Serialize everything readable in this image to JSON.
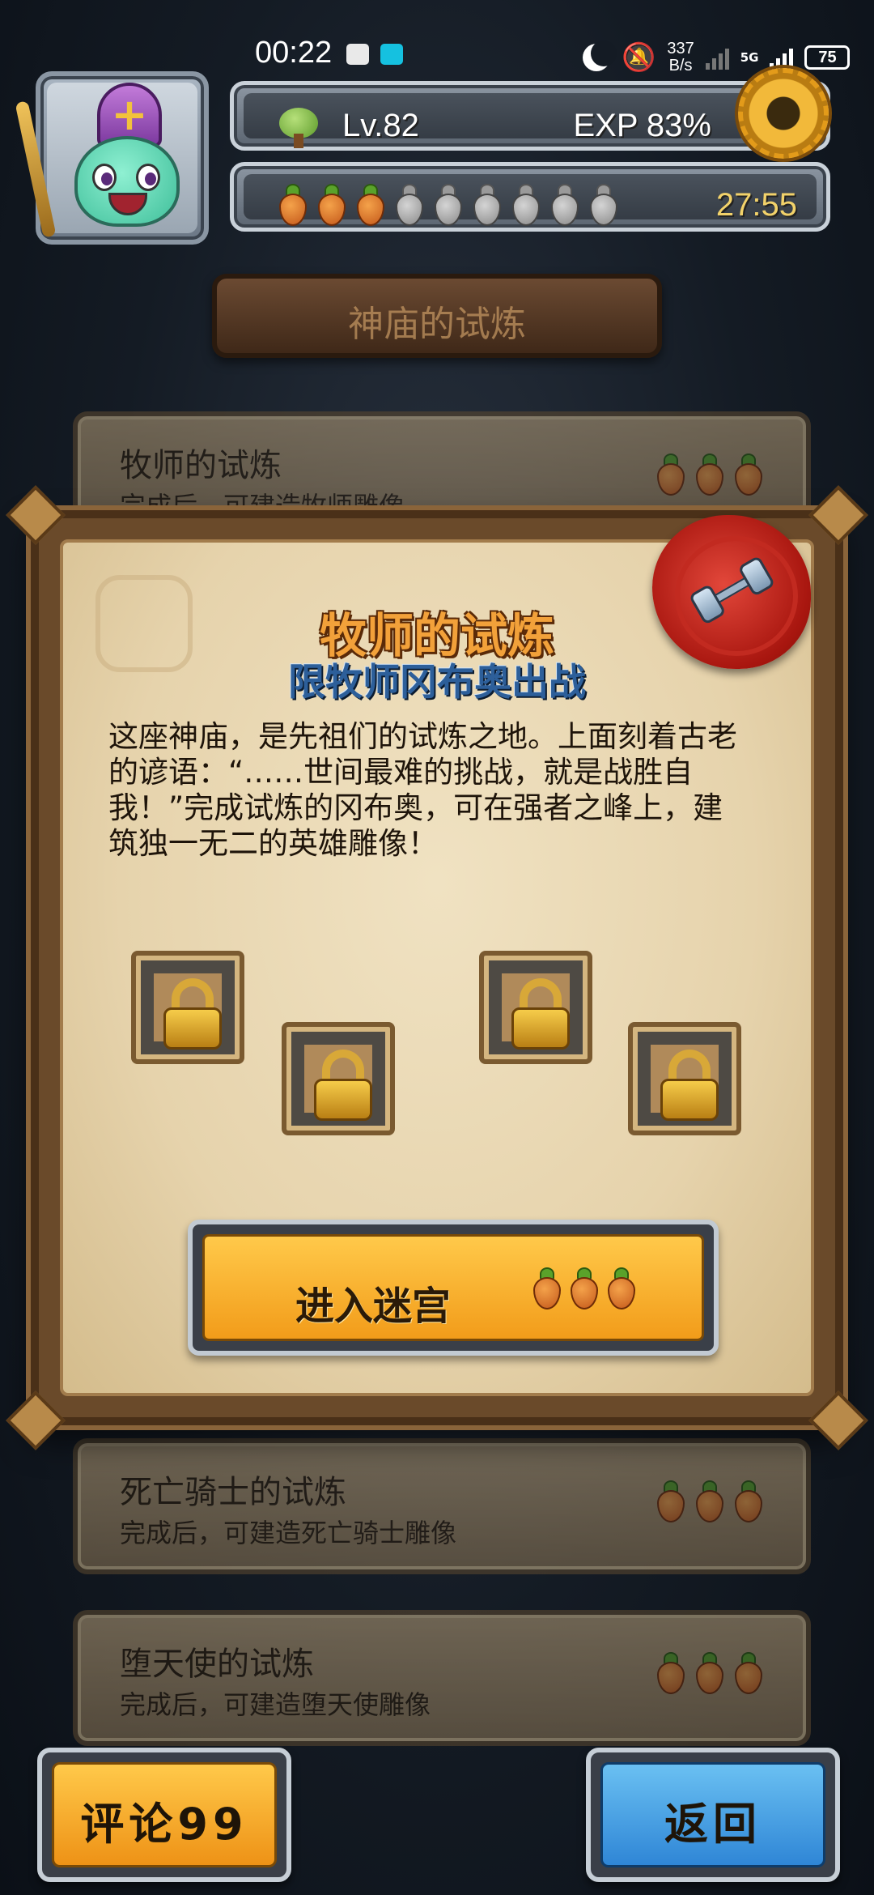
{
  "status_bar": {
    "time": "00:22",
    "network_speed_value": "337",
    "network_speed_unit": "B/s",
    "network_type": "5G",
    "battery": "75"
  },
  "hud": {
    "level": "Lv.82",
    "exp": "EXP 83%",
    "energy_full": 3,
    "energy_total": 9,
    "timer": "27:55"
  },
  "page": {
    "title": "神庙的试炼"
  },
  "trials": [
    {
      "title": "牧师的试炼",
      "subtitle": "完成后，可建造牧师雕像",
      "cost_carrots": 3
    },
    {
      "title": "死亡骑士的试炼",
      "subtitle": "完成后，可建造死亡骑士雕像",
      "cost_carrots": 3
    },
    {
      "title": "堕天使的试炼",
      "subtitle": "完成后，可建造堕天使雕像",
      "cost_carrots": 3
    }
  ],
  "modal": {
    "title": "牧师的试炼",
    "subtitle": "限牧师冈布奥出战",
    "description": "这座神庙，是先祖们的试炼之地。上面刻着古老的谚语：“……世间最难的挑战，就是战胜自我！”完成试炼的冈布奥，可在强者之峰上，建筑独一无二的英雄雕像！",
    "locked_slots": 4,
    "enter_label": "进入迷宫",
    "enter_cost_carrots": 3,
    "seal_icon": "dumbbell-icon"
  },
  "bottom": {
    "comment_label": "评论99",
    "back_label": "返回"
  },
  "colors": {
    "accent_orange": "#F29C1A",
    "back_blue": "#2F86D6",
    "seal_red": "#A8160F"
  }
}
